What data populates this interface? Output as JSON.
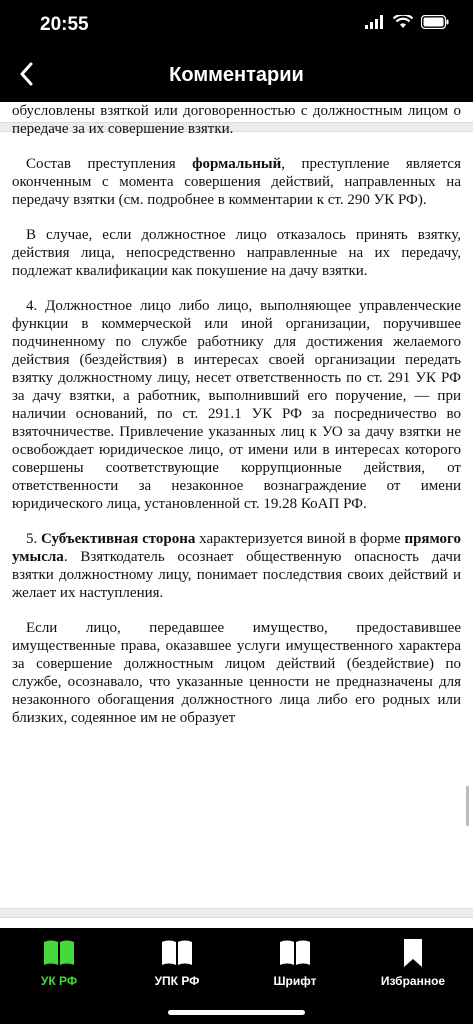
{
  "status": {
    "time": "20:55"
  },
  "nav": {
    "title": "Комментарии"
  },
  "paragraphs": {
    "p1": "обусловлены взяткой или договоренностью с должностным лицом о передаче за их совершение взятки.",
    "p2a": "Состав преступления ",
    "p2b": "формальный",
    "p2c": ", преступление является оконченным с момента совершения действий, направленных на передачу взятки (см. подробнее в комментарии к ст. 290 УК РФ).",
    "p3": "В случае, если должностное лицо отказалось принять взятку, действия лица, непосредственно направленные на их передачу, подлежат квалификации как покушение на дачу взятки.",
    "p4": "4. Должностное лицо либо лицо, выполняющее управленческие функции в коммерческой или иной организации, поручившее подчиненному по службе работнику для достижения желаемого действия (бездействия) в интересах своей организации передать взятку должностному лицу, несет ответственность по ст. 291 УК РФ за дачу взятки, а работник, выполнивший его поручение, — при наличии оснований, по ст. 291.1 УК РФ за посредничество во взяточничестве. Привлечение указанных лиц к УО за дачу взятки не освобождает юридическое лицо, от имени или в интересах которого совершены соответствующие коррупционные действия, от ответственности за незаконное вознаграждение от имени юридического лица, установленной ст. 19.28 КоАП РФ.",
    "p5a": "5. ",
    "p5b": "Субъективная сторона",
    "p5c": " характеризуется виной в форме ",
    "p5d": "прямого умысла",
    "p5e": ". Взяткодатель осознает общественную опасность дачи взятки должностному лицу, понимает последствия своих действий и желает их наступления.",
    "p6": "Если лицо, передавшее имущество, предоставившее имущественные права, оказавшее услуги имущественного характера за совершение должностным лицом действий (бездействие) по службе, осознавало, что указанные ценности не предназначены для незаконного обогащения должностного лица либо его родных или близких, содеянное им не образует"
  },
  "tabs": [
    {
      "label": "УК РФ",
      "icon": "book-open-icon",
      "active": true
    },
    {
      "label": "УПК РФ",
      "icon": "book-open-icon",
      "active": false
    },
    {
      "label": "Шрифт",
      "icon": "book-open-icon",
      "active": false
    },
    {
      "label": "Избранное",
      "icon": "bookmark-icon",
      "active": false
    }
  ],
  "colors": {
    "accent": "#46d93b",
    "bar": "#000000"
  }
}
